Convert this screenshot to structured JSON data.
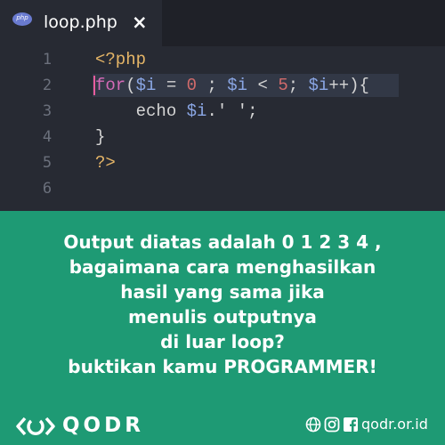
{
  "tab": {
    "title": "loop.php",
    "close": "×",
    "icon_text": "php",
    "icon": "php-file-icon"
  },
  "code": {
    "lines": [
      {
        "n": "1"
      },
      {
        "n": "2"
      },
      {
        "n": "3"
      },
      {
        "n": "4"
      },
      {
        "n": "5"
      },
      {
        "n": "6"
      }
    ],
    "line1": "<?php",
    "line2": {
      "kw": "for",
      "open": "(",
      "v1": "$i",
      "eq": " = ",
      "zero": "0",
      "semi1": " ; ",
      "v2": "$i",
      "lt": " < ",
      "five": "5",
      "semi2": "; ",
      "v3": "$i",
      "inc": "++",
      "close": "){"
    },
    "line3": {
      "indent": "    ",
      "kw": "echo",
      "sp": " ",
      "var": "$i",
      "dot": ".",
      "str": "' '",
      "semi": ";"
    },
    "line4": "}",
    "line5": "?>"
  },
  "message": [
    "Output diatas adalah 0 1 2 3 4 ,",
    "bagaimana cara menghasilkan",
    "hasil yang sama jika",
    "menulis outputnya",
    "di luar loop?",
    "buktikan kamu PROGRAMMER!"
  ],
  "footer": {
    "brand": "QODR",
    "site": "qodr.or.id",
    "icons": [
      "globe-icon",
      "instagram-icon",
      "facebook-icon"
    ]
  },
  "colors": {
    "editor_bg": "#272a33",
    "green": "#1e9a74",
    "text": "#ffffff"
  }
}
